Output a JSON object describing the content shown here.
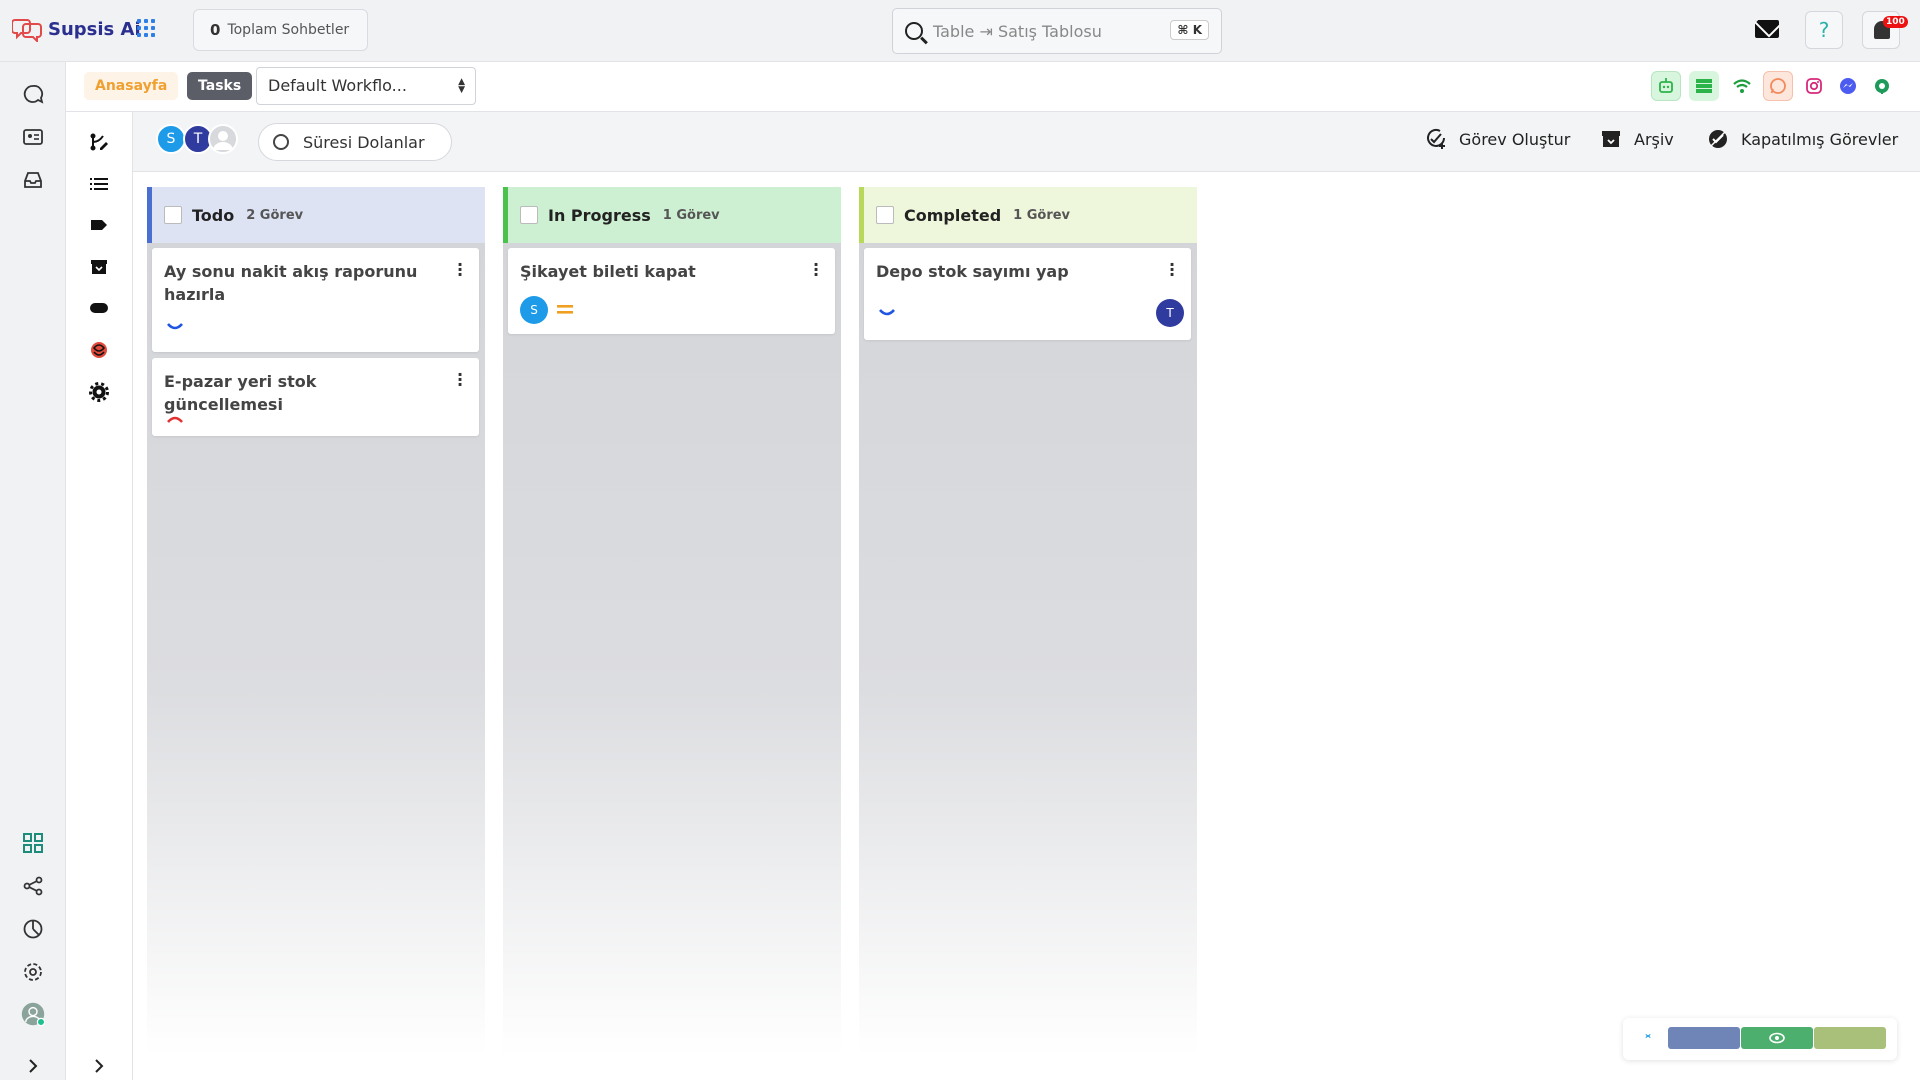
{
  "app": {
    "logo_text": "Supsis Ai",
    "colors": {
      "brand": "#2b2f8f",
      "accent": "#2e7ee6"
    }
  },
  "topbar": {
    "chats_count": "0",
    "chats_label": "Toplam Sohbetler",
    "search_placeholder": "Table ⇥ Satış Tablosu",
    "search_shortcut": "⌘ K",
    "help_icon": "?",
    "notification_count": "100"
  },
  "subheader": {
    "home_label": "Anasayfa",
    "tasks_label": "Tasks",
    "workflow_selected": "Default Workflo...",
    "channels": [
      "bot-icon",
      "list-icon",
      "wifi-icon",
      "whatsapp-icon",
      "instagram-icon",
      "messenger-icon",
      "leaf-icon"
    ]
  },
  "toolbar": {
    "avatars": [
      "S",
      "T"
    ],
    "expired_label": "Süresi Dolanlar",
    "create_task_label": "Görev Oluştur",
    "archive_label": "Arşiv",
    "closed_tasks_label": "Kapatılmış Görevler"
  },
  "board": {
    "columns": [
      {
        "title": "Todo",
        "count": "2 Görev",
        "color": "#4a6fd1",
        "header_bg": "#dde3f3",
        "cards": [
          {
            "title": "Ay sonu nakit akış raporunu hazırla",
            "priority": "low"
          },
          {
            "title": "E-pazar yeri stok güncellemesi",
            "priority": "high"
          }
        ]
      },
      {
        "title": "In Progress",
        "count": "1 Görev",
        "color": "#4cc24c",
        "header_bg": "#cdf0d2",
        "cards": [
          {
            "title": "Şikayet bileti kapat",
            "priority": "medium",
            "assignee": "S"
          }
        ]
      },
      {
        "title": "Completed",
        "count": "1 Görev",
        "color": "#b7d85a",
        "header_bg": "#eef6dc",
        "cards": [
          {
            "title": "Depo stok sayımı yap",
            "priority": "low",
            "assignee": "T"
          }
        ]
      }
    ]
  }
}
